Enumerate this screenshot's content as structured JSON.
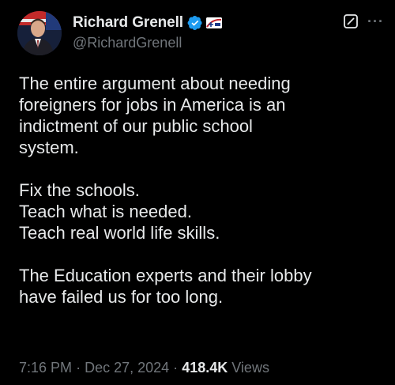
{
  "author": {
    "display_name": "Richard Grenell",
    "handle": "@RichardGrenell",
    "verified_badge": "verified-check-icon",
    "verified_color": "#1d9bf0",
    "affiliate_badge": "affiliate-logo-icon"
  },
  "actions": {
    "grok_icon": "grok-icon",
    "more_icon": "more-icon",
    "more_label": "···"
  },
  "body": {
    "paragraphs": [
      [
        "The entire argument about needing",
        "foreigners for jobs in America is an",
        "indictment of our public school",
        "system."
      ],
      [
        "Fix the schools.",
        "Teach what is needed.",
        "Teach real world life skills."
      ],
      [
        "The Education experts and their lobby",
        "have failed us for too long."
      ]
    ]
  },
  "meta": {
    "time": "7:16 PM",
    "separator": "·",
    "date": "Dec 27, 2024",
    "views_count": "418.4K",
    "views_label": "Views"
  },
  "colors": {
    "background": "#000000",
    "text": "#e7e9ea",
    "secondary": "#71767b"
  }
}
